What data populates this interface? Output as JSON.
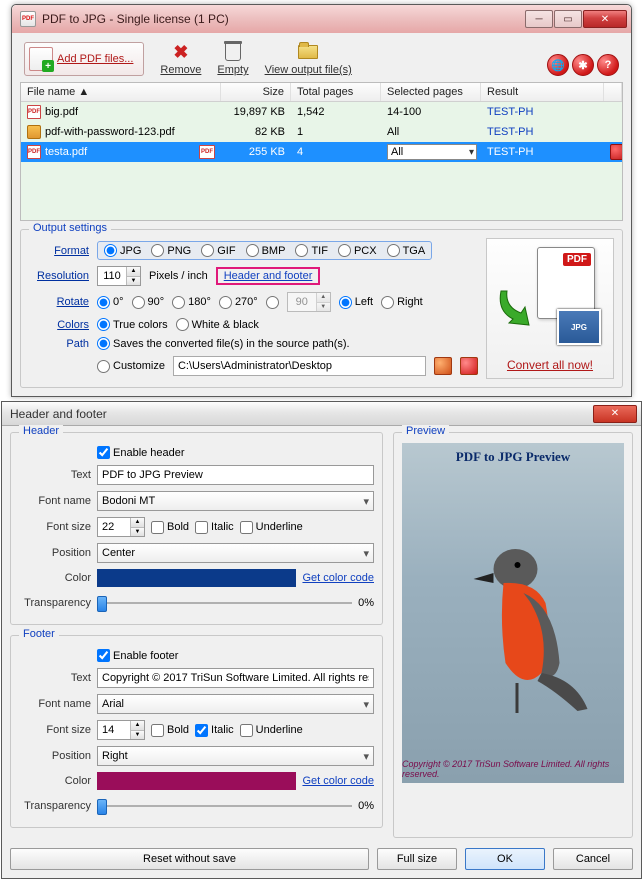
{
  "win1": {
    "title": "PDF to JPG - Single license (1 PC)",
    "toolbar": {
      "add": "Add PDF files...",
      "remove": "Remove",
      "empty": "Empty",
      "viewout": "View output file(s)"
    },
    "grid": {
      "cols": {
        "fname": "File name ▲",
        "size": "Size",
        "pages": "Total pages",
        "sel": "Selected pages",
        "result": "Result"
      },
      "rows": [
        {
          "name": "big.pdf",
          "size": "19,897 KB",
          "pages": "1,542",
          "sel": "14-100",
          "result": "TEST-PH",
          "icon": "pdf"
        },
        {
          "name": "pdf-with-password-123.pdf",
          "size": "82 KB",
          "pages": "1",
          "sel": "All",
          "result": "TEST-PH",
          "icon": "lock"
        },
        {
          "name": "testa.pdf",
          "size": "255 KB",
          "pages": "4",
          "sel": "All",
          "result": "TEST-PH",
          "icon": "pdf",
          "selected": true
        }
      ]
    },
    "settings": {
      "legend": "Output settings",
      "format": {
        "label": "Format",
        "opts": [
          "JPG",
          "PNG",
          "GIF",
          "BMP",
          "TIF",
          "PCX",
          "TGA"
        ]
      },
      "resolution": {
        "label": "Resolution",
        "value": "110",
        "unit": "Pixels / inch",
        "hf": "Header and footer"
      },
      "rotate": {
        "label": "Rotate",
        "angles": [
          "0°",
          "90°",
          "180°",
          "270°"
        ],
        "custom": "90",
        "left": "Left",
        "right": "Right"
      },
      "colors": {
        "label": "Colors",
        "truecolors": "True colors",
        "wb": "White & black"
      },
      "path": {
        "label": "Path",
        "same": "Saves the converted file(s) in the source path(s).",
        "custom": "Customize",
        "value": "C:\\Users\\Administrator\\Desktop"
      },
      "convert": "Convert all now!",
      "jpg": "JPG",
      "pdf": "PDF"
    }
  },
  "win2": {
    "title": "Header and footer",
    "header": {
      "legend": "Header",
      "enable": "Enable header",
      "text_label": "Text",
      "text": "PDF to JPG Preview",
      "font_label": "Font name",
      "font": "Bodoni MT",
      "size_label": "Font size",
      "size": "22",
      "bold": "Bold",
      "italic": "Italic",
      "underline": "Underline",
      "pos_label": "Position",
      "pos": "Center",
      "color_label": "Color",
      "color": "#0b3a8a",
      "getcolor": "Get color code",
      "trans_label": "Transparency",
      "trans": "0%"
    },
    "footer": {
      "legend": "Footer",
      "enable": "Enable footer",
      "text_label": "Text",
      "text": "Copyright © 2017 TriSun Software Limited. All rights reserved.",
      "font_label": "Font name",
      "font": "Arial",
      "size_label": "Font size",
      "size": "14",
      "bold": "Bold",
      "italic": "Italic",
      "underline": "Underline",
      "pos_label": "Position",
      "pos": "Right",
      "color_label": "Color",
      "color": "#9a0d5a",
      "getcolor": "Get color code",
      "trans_label": "Transparency",
      "trans": "0%"
    },
    "preview": {
      "legend": "Preview",
      "title": "PDF to JPG Preview",
      "footer": "Copyright © 2017 TriSun Software Limited. All rights reserved."
    },
    "buttons": {
      "reset": "Reset without save",
      "fullsize": "Full size",
      "ok": "OK",
      "cancel": "Cancel"
    }
  }
}
